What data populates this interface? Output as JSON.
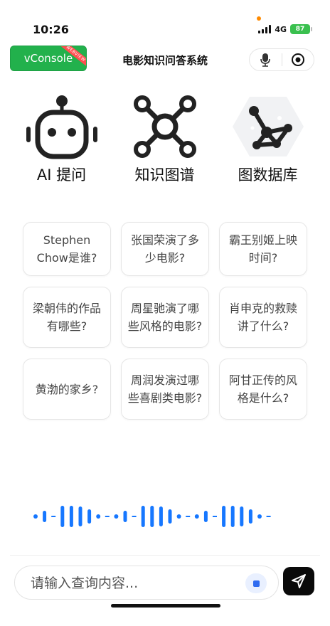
{
  "status_bar": {
    "time": "10:26",
    "network": "4G",
    "battery": "87"
  },
  "nav": {
    "vconsole_label": "vConsole",
    "vconsole_ribbon": "WEBVIEW",
    "title": "电影知识问答系统",
    "mic_icon": "microphone-icon",
    "record_icon": "record-icon"
  },
  "features": [
    {
      "label": "AI 提问",
      "icon": "robot-icon"
    },
    {
      "label": "知识图谱",
      "icon": "graph-nodes-icon"
    },
    {
      "label": "图数据库",
      "icon": "neo4j-graph-icon"
    }
  ],
  "questions": [
    "Stephen Chow是谁?",
    "张国荣演了多少电影?",
    "霸王别姬上映时间?",
    "梁朝伟的作品有哪些?",
    "周星驰演了哪些风格的电影?",
    "肖申克的救赎讲了什么?",
    "黄渤的家乡?",
    "周润发演过哪些喜剧类电影?",
    "阿甘正传的风格是什么?"
  ],
  "input": {
    "placeholder": "请输入查询内容..."
  },
  "colors": {
    "accent_blue": "#1677ff",
    "vconsole_green": "#22b14c",
    "battery_green": "#3ac04f"
  }
}
